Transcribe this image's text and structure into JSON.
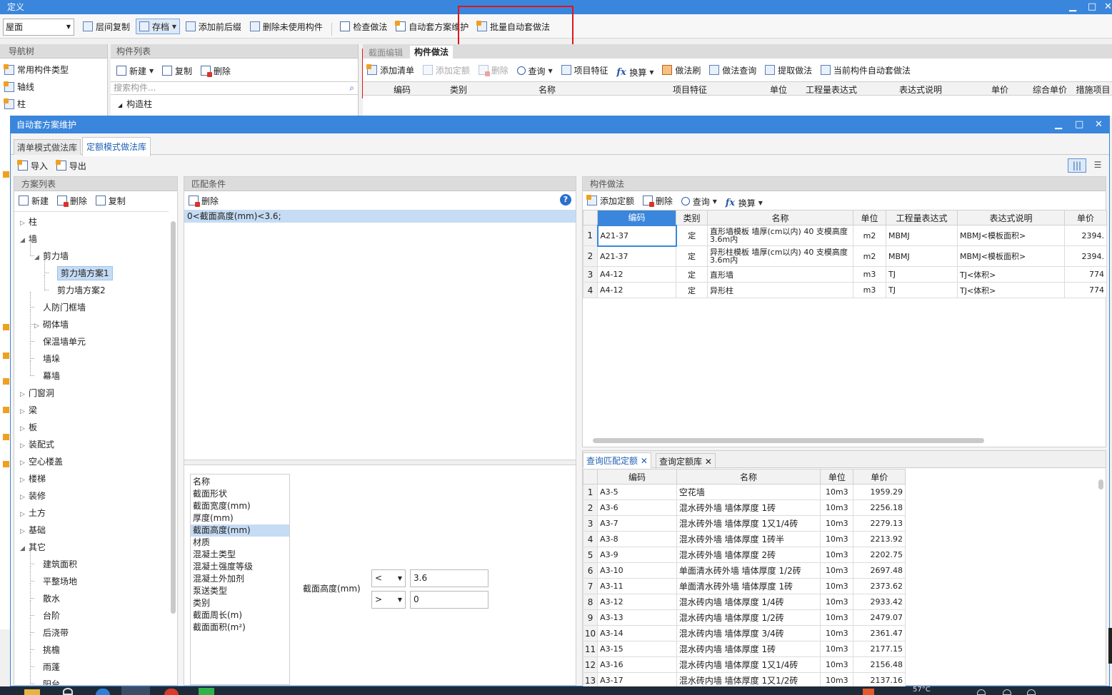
{
  "outer": {
    "title": "定义",
    "floor_value": "屋面",
    "toolbar": {
      "floor_copy": "层间复制",
      "archive": "存档",
      "add_prefix": "添加前后缀",
      "delete_unused": "删除未使用构件",
      "check": "检查做法",
      "auto_maint": "自动套方案维护",
      "batch_auto": "批量自动套做法"
    },
    "nav_title": "导航树",
    "nav_items": [
      "常用构件类型",
      "轴线",
      "柱"
    ],
    "comp_title": "构件列表",
    "comp_new": "新建",
    "comp_copy": "复制",
    "comp_delete": "删除",
    "comp_search_placeholder": "搜索构件...",
    "comp_node": "构造柱",
    "tab_section": "截面编辑",
    "tab_method": "构件做法",
    "method_tb": {
      "add_list": "添加清单",
      "add_quota": "添加定额",
      "delete": "删除",
      "query": "查询",
      "feature": "项目特征",
      "calc": "换算",
      "brush": "做法刷",
      "method_query": "做法查询",
      "extract": "提取做法",
      "cur_auto": "当前构件自动套做法"
    },
    "method_cols": [
      "编码",
      "类别",
      "名称",
      "项目特征",
      "单位",
      "工程量表达式",
      "表达式说明",
      "单价",
      "综合单价",
      "措施项目"
    ]
  },
  "dialog": {
    "title": "自动套方案维护",
    "tab_list": "清单模式做法库",
    "tab_quota": "定额模式做法库",
    "import": "导入",
    "export": "导出",
    "plan_title": "方案列表",
    "plan_new": "新建",
    "plan_delete": "删除",
    "plan_copy": "复制",
    "tree": [
      {
        "label": "柱",
        "level": 0,
        "exp": "▷"
      },
      {
        "label": "墙",
        "level": 0,
        "exp": "◢"
      },
      {
        "label": "剪力墙",
        "level": 1,
        "exp": "◢"
      },
      {
        "label": "剪力墙方案1",
        "level": 2,
        "exp": "",
        "sel": true
      },
      {
        "label": "剪力墙方案2",
        "level": 2,
        "exp": ""
      },
      {
        "label": "人防门框墙",
        "level": 1,
        "exp": ""
      },
      {
        "label": "砌体墙",
        "level": 1,
        "exp": "▷"
      },
      {
        "label": "保温墙单元",
        "level": 1,
        "exp": ""
      },
      {
        "label": "墙垛",
        "level": 1,
        "exp": ""
      },
      {
        "label": "幕墙",
        "level": 1,
        "exp": ""
      },
      {
        "label": "门窗洞",
        "level": 0,
        "exp": "▷"
      },
      {
        "label": "梁",
        "level": 0,
        "exp": "▷"
      },
      {
        "label": "板",
        "level": 0,
        "exp": "▷"
      },
      {
        "label": "装配式",
        "level": 0,
        "exp": "▷"
      },
      {
        "label": "空心楼盖",
        "level": 0,
        "exp": "▷"
      },
      {
        "label": "楼梯",
        "level": 0,
        "exp": "▷"
      },
      {
        "label": "装修",
        "level": 0,
        "exp": "▷"
      },
      {
        "label": "土方",
        "level": 0,
        "exp": "▷"
      },
      {
        "label": "基础",
        "level": 0,
        "exp": "▷"
      },
      {
        "label": "其它",
        "level": 0,
        "exp": "◢"
      },
      {
        "label": "建筑面积",
        "level": 1,
        "exp": ""
      },
      {
        "label": "平整场地",
        "level": 1,
        "exp": ""
      },
      {
        "label": "散水",
        "level": 1,
        "exp": ""
      },
      {
        "label": "台阶",
        "level": 1,
        "exp": ""
      },
      {
        "label": "后浇带",
        "level": 1,
        "exp": ""
      },
      {
        "label": "挑檐",
        "level": 1,
        "exp": ""
      },
      {
        "label": "雨蓬",
        "level": 1,
        "exp": ""
      },
      {
        "label": "阳台",
        "level": 1,
        "exp": ""
      }
    ],
    "match_title": "匹配条件",
    "match_delete": "删除",
    "match_condition": "0<截面高度(mm)<3.6;",
    "attrs": [
      "名称",
      "截面形状",
      "截面宽度(mm)",
      "厚度(mm)",
      "截面高度(mm)",
      "材质",
      "混凝土类型",
      "混凝土强度等级",
      "混凝土外加剂",
      "泵送类型",
      "类别",
      "截面周长(m)",
      "截面面积(m²)"
    ],
    "attr_selected": 4,
    "cond_label": "截面高度(mm)",
    "op1": "<",
    "val1": "3.6",
    "op2": ">",
    "val2": "0",
    "cm_title": "构件做法",
    "cm_add_quota": "添加定额",
    "cm_delete": "删除",
    "cm_query": "查询",
    "cm_calc": "换算",
    "cm_cols": [
      "编码",
      "类别",
      "名称",
      "单位",
      "工程量表达式",
      "表达式说明",
      "单价"
    ],
    "cm_rows": [
      {
        "n": "1",
        "code": "A21-37",
        "type": "定",
        "name": "直形墙模板 墙厚(cm以内) 40 支模高度3.6m内",
        "unit": "m2",
        "expr": "MBMJ",
        "desc": "MBMJ<模板面积>",
        "price": "2394."
      },
      {
        "n": "2",
        "code": "A21-37",
        "type": "定",
        "name": "异形柱模板 墙厚(cm以内) 40 支模高度3.6m内",
        "unit": "m2",
        "expr": "MBMJ",
        "desc": "MBMJ<模板面积>",
        "price": "2394."
      },
      {
        "n": "3",
        "code": "A4-12",
        "type": "定",
        "name": "直形墙",
        "unit": "m3",
        "expr": "TJ",
        "desc": "TJ<体积>",
        "price": "774"
      },
      {
        "n": "4",
        "code": "A4-12",
        "type": "定",
        "name": "异形柱",
        "unit": "m3",
        "expr": "TJ",
        "desc": "TJ<体积>",
        "price": "774"
      }
    ],
    "q_tab1": "查询匹配定额",
    "q_tab2": "查询定额库",
    "q_cols": [
      "编码",
      "名称",
      "单位",
      "单价"
    ],
    "q_rows": [
      {
        "n": "1",
        "code": "A3-5",
        "name": "空花墙",
        "unit": "10m3",
        "price": "1959.29"
      },
      {
        "n": "2",
        "code": "A3-6",
        "name": "混水砖外墙 墙体厚度 1砖",
        "unit": "10m3",
        "price": "2256.18"
      },
      {
        "n": "3",
        "code": "A3-7",
        "name": "混水砖外墙 墙体厚度 1又1/4砖",
        "unit": "10m3",
        "price": "2279.13"
      },
      {
        "n": "4",
        "code": "A3-8",
        "name": "混水砖外墙 墙体厚度 1砖半",
        "unit": "10m3",
        "price": "2213.92"
      },
      {
        "n": "5",
        "code": "A3-9",
        "name": "混水砖外墙 墙体厚度 2砖",
        "unit": "10m3",
        "price": "2202.75"
      },
      {
        "n": "6",
        "code": "A3-10",
        "name": "单面清水砖外墙 墙体厚度 1/2砖",
        "unit": "10m3",
        "price": "2697.48"
      },
      {
        "n": "7",
        "code": "A3-11",
        "name": "单面清水砖外墙 墙体厚度 1砖",
        "unit": "10m3",
        "price": "2373.62"
      },
      {
        "n": "8",
        "code": "A3-12",
        "name": "混水砖内墙 墙体厚度 1/4砖",
        "unit": "10m3",
        "price": "2933.42"
      },
      {
        "n": "9",
        "code": "A3-13",
        "name": "混水砖内墙 墙体厚度 1/2砖",
        "unit": "10m3",
        "price": "2479.07"
      },
      {
        "n": "10",
        "code": "A3-14",
        "name": "混水砖内墙 墙体厚度 3/4砖",
        "unit": "10m3",
        "price": "2361.47"
      },
      {
        "n": "11",
        "code": "A3-15",
        "name": "混水砖内墙 墙体厚度 1砖",
        "unit": "10m3",
        "price": "2177.15"
      },
      {
        "n": "12",
        "code": "A3-16",
        "name": "混水砖内墙 墙体厚度 1又1/4砖",
        "unit": "10m3",
        "price": "2156.48"
      },
      {
        "n": "13",
        "code": "A3-17",
        "name": "混水砖内墙 墙体厚度 1又1/2砖",
        "unit": "10m3",
        "price": "2137.16"
      }
    ]
  },
  "taskbar": {
    "temp": "57°C"
  },
  "colors": {
    "titlebar": "#3a86dc",
    "highlight_box": "#e0151c",
    "selection": "#c5dcf4"
  }
}
